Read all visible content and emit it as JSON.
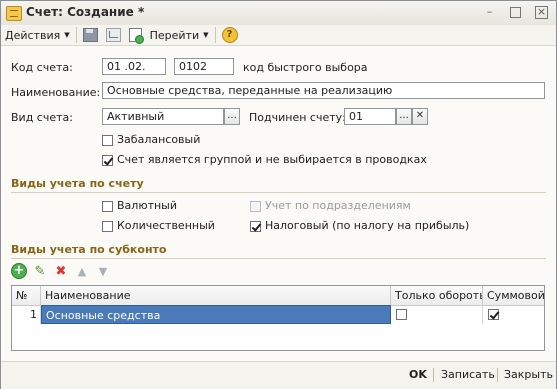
{
  "window": {
    "title": "Счет: Создание *",
    "minimize_glyph": "–",
    "close_glyph": "×"
  },
  "toolbar": {
    "actions_label": "Действия",
    "goto_label": "Перейти",
    "help_glyph": "?"
  },
  "form": {
    "code_label": "Код счета:",
    "code_value": "01 .02.",
    "quick_code_value": "0102",
    "quick_code_label": "код быстрого выбора",
    "name_label": "Наименование:",
    "name_value": "Основные средства, переданные на реализацию",
    "type_label": "Вид счета:",
    "type_value": "Активный",
    "parent_label": "Подчинен счету:",
    "parent_value": "01",
    "offbalance_label": "Забалансовый",
    "offbalance_checked": false,
    "group_label": "Счет является группой и не выбирается в проводках",
    "group_checked": true
  },
  "accounting_section": {
    "title": "Виды учета по счету",
    "currency_label": "Валютный",
    "currency_checked": false,
    "quantity_label": "Количественный",
    "quantity_checked": false,
    "division_label": "Учет по подразделениям",
    "division_checked": false,
    "tax_label": "Налоговый (по налогу на прибыль)",
    "tax_checked": true
  },
  "subconto_section": {
    "title": "Виды учета по субконто",
    "columns": {
      "num": "№",
      "name": "Наименование",
      "turnover_only": "Только обороты",
      "sum": "Суммовой"
    },
    "rows": [
      {
        "num": "1",
        "name": "Основные средства",
        "turnover_only": false,
        "sum": true
      }
    ]
  },
  "footer": {
    "ok_label": "OK",
    "save_label": "Записать",
    "close_label": "Закрыть"
  },
  "colors": {
    "section_title": "#8a6416",
    "selection": "#4a7ab8"
  }
}
